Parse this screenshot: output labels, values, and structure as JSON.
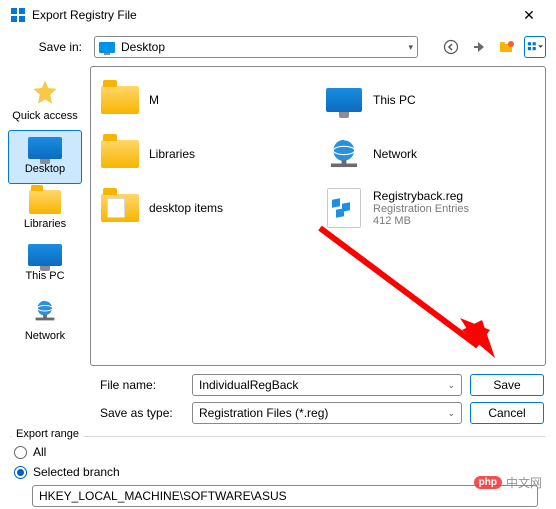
{
  "window": {
    "title": "Export Registry File"
  },
  "savein": {
    "label": "Save in:",
    "value": "Desktop"
  },
  "toolbar": {
    "back": "back-icon",
    "up": "up-one-level-icon",
    "newfolder": "new-folder-icon",
    "viewmenu": "view-menu-icon"
  },
  "places": [
    {
      "id": "quick-access",
      "label": "Quick access"
    },
    {
      "id": "desktop",
      "label": "Desktop",
      "selected": true
    },
    {
      "id": "libraries",
      "label": "Libraries"
    },
    {
      "id": "this-pc",
      "label": "This PC"
    },
    {
      "id": "network",
      "label": "Network"
    }
  ],
  "files": [
    {
      "name": "M",
      "kind": "folder"
    },
    {
      "name": "This PC",
      "kind": "thispc"
    },
    {
      "name": "Libraries",
      "kind": "folder"
    },
    {
      "name": "Network",
      "kind": "network"
    },
    {
      "name": "desktop items",
      "kind": "folder-docs"
    },
    {
      "name": "Registryback.reg",
      "kind": "regfile",
      "type": "Registration Entries",
      "size": "412 MB"
    }
  ],
  "form": {
    "filename_label": "File name:",
    "filename_value": "IndividualRegBack",
    "saveas_label": "Save as type:",
    "saveas_value": "Registration Files (*.reg)",
    "save_btn": "Save",
    "cancel_btn": "Cancel"
  },
  "export": {
    "legend": "Export range",
    "all_label": "All",
    "selected_label": "Selected branch",
    "selected_checked": true,
    "branch_path": "HKEY_LOCAL_MACHINE\\SOFTWARE\\ASUS"
  },
  "watermark": {
    "badge": "php",
    "text": "中文网"
  },
  "colors": {
    "accent": "#0078d4",
    "arrow": "#ff0000"
  }
}
